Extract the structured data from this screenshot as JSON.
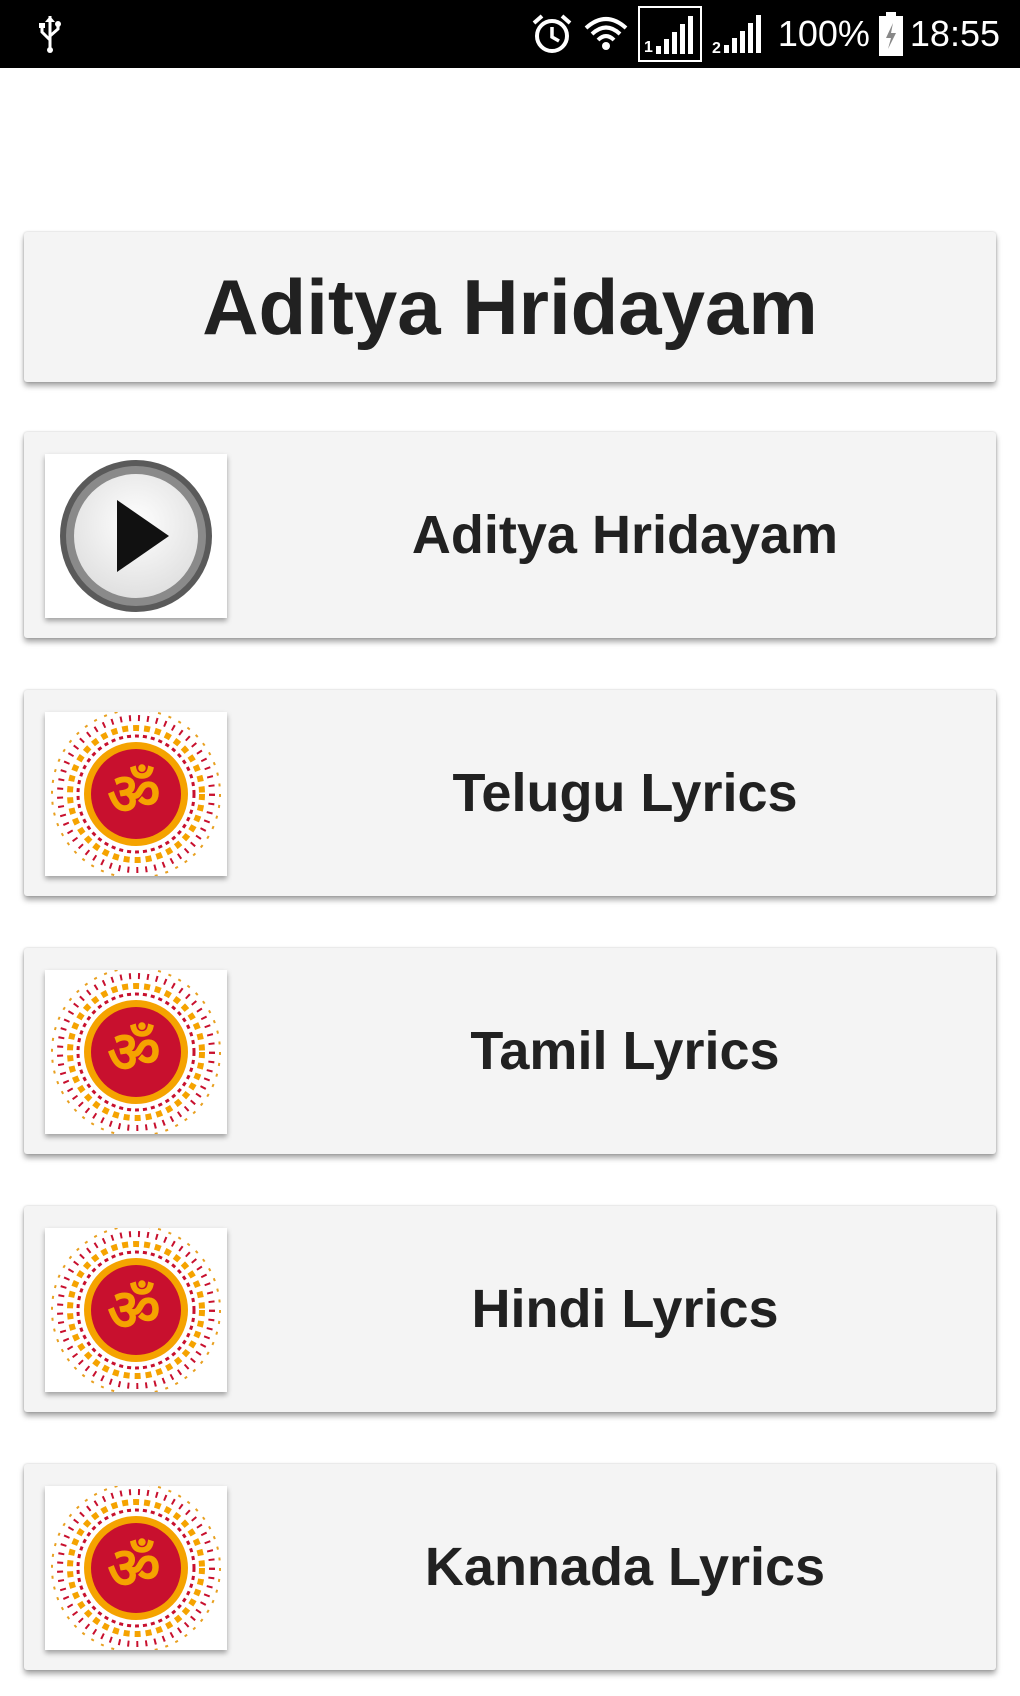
{
  "status_bar": {
    "battery_percent": "100%",
    "time": "18:55",
    "icons": [
      "usb-icon",
      "alarm-icon",
      "wifi-icon",
      "signal-sim1-icon",
      "signal-sim2-icon",
      "battery-charging-icon"
    ]
  },
  "header": {
    "title": "Aditya Hridayam"
  },
  "menu": {
    "items": [
      {
        "label": "Aditya Hridayam",
        "icon": "play-icon"
      },
      {
        "label": "Telugu Lyrics",
        "icon": "om-mandala-icon"
      },
      {
        "label": "Tamil Lyrics",
        "icon": "om-mandala-icon"
      },
      {
        "label": "Hindi Lyrics",
        "icon": "om-mandala-icon"
      },
      {
        "label": "Kannada Lyrics",
        "icon": "om-mandala-icon"
      }
    ]
  },
  "colors": {
    "card_bg": "#f4f4f4",
    "text": "#212121",
    "om_red": "#c8102e",
    "om_orange": "#f5a300"
  }
}
